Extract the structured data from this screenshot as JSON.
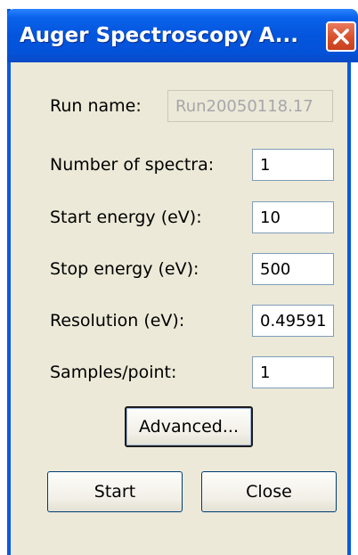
{
  "window": {
    "title": "Auger Spectroscopy A...",
    "close_icon": "close-icon"
  },
  "fields": {
    "run_name": {
      "label": "Run name:",
      "value": "Run20050118.17"
    },
    "num_spectra": {
      "label": "Number of spectra:",
      "value": "1"
    },
    "start_energy": {
      "label": "Start energy (eV):",
      "value": "10"
    },
    "stop_energy": {
      "label": "Stop energy (eV):",
      "value": "500"
    },
    "resolution": {
      "label": "Resolution (eV):",
      "value": "0.49591"
    },
    "samples_point": {
      "label": "Samples/point:",
      "value": "1"
    }
  },
  "buttons": {
    "advanced": "Advanced...",
    "start": "Start",
    "close": "Close"
  },
  "colors": {
    "titlebar": "#0455dd",
    "window_bg": "#ece9d8",
    "close_button": "#d7502a"
  }
}
